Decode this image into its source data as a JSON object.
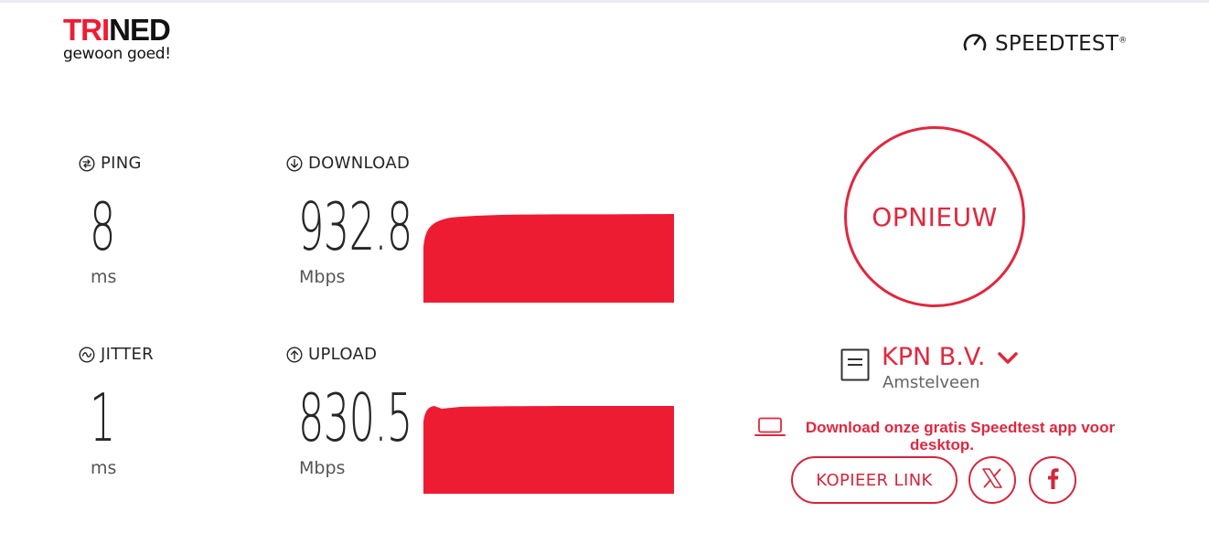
{
  "logo": {
    "part1": "TRI",
    "part2": "NED",
    "tagline": "gewoon goed!"
  },
  "brand": {
    "label": "SPEEDTEST",
    "trademark": "®",
    "icon": "gauge-icon"
  },
  "metrics": {
    "ping": {
      "label": "PING",
      "value": "8",
      "unit": "ms",
      "icon": "ping-icon"
    },
    "jitter": {
      "label": "JITTER",
      "value": "1",
      "unit": "ms",
      "icon": "jitter-icon"
    },
    "download": {
      "label": "DOWNLOAD",
      "value": "932.8",
      "unit": "Mbps",
      "icon": "arrow-down-circle-icon"
    },
    "upload": {
      "label": "UPLOAD",
      "value": "830.5",
      "unit": "Mbps",
      "icon": "arrow-up-circle-icon"
    }
  },
  "actions": {
    "again_label": "OPNIEUW"
  },
  "server": {
    "name": "KPN B.V.",
    "location": "Amstelveen",
    "icon": "server-icon"
  },
  "promo": {
    "text": "Download onze gratis Speedtest app voor desktop.",
    "icon": "laptop-icon"
  },
  "share": {
    "copy_label": "KOPIEER LINK",
    "x_icon": "x-icon",
    "facebook_icon": "facebook-icon"
  },
  "colors": {
    "accent": "#e0283e",
    "graph_fill": "#ee1c33",
    "text": "#262626"
  }
}
